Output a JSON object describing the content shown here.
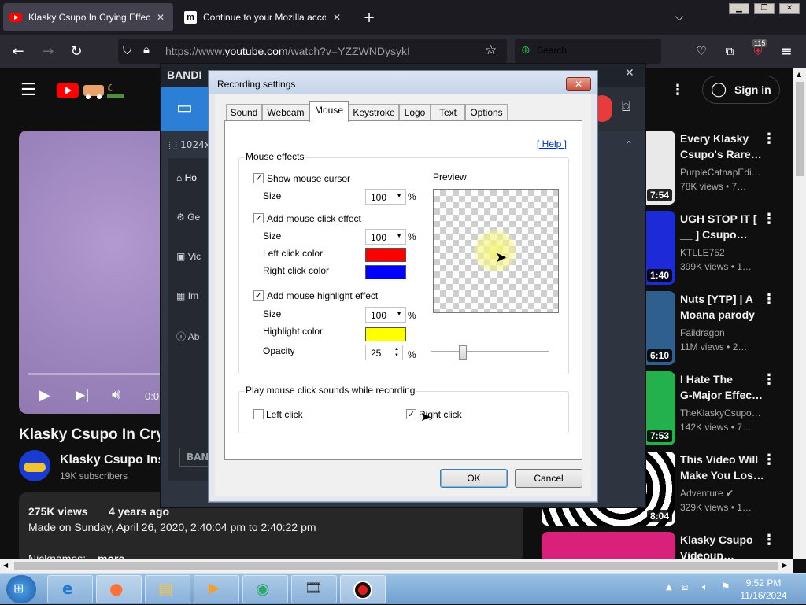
{
  "browser": {
    "tabs": [
      {
        "title": "Klasky Csupo In Crying Effect (K",
        "active": true
      },
      {
        "title": "Continue to your Mozilla accou",
        "active": false
      }
    ],
    "new_tab_glyph": "+",
    "url_prefix": "https://www.",
    "url_host": "youtube.com",
    "url_rest": "/watch?v=YZZWNDysykI",
    "search_placeholder": "Search",
    "extensions_badge": "115"
  },
  "youtube": {
    "sign_in": "Sign in",
    "video_title": "Klasky Csupo In Cry",
    "channel_name": "Klasky Csupo Inst",
    "subscribers": "19K subscribers",
    "player_time": "0:0",
    "views": "275K views",
    "age": "4 years ago",
    "description": "Made on Sunday, April 26, 2020, 2:40:04 pm to 2:40:22 pm",
    "nicknames": "Nicknames:",
    "more": "more",
    "related": [
      {
        "title1": "Every Klasky",
        "title2": "Csupo's Rare…",
        "channel": "PurpleCatnapEdi…",
        "meta": "78K views  • 7…",
        "duration": "7:54",
        "thumb": "#e9e9e9"
      },
      {
        "title1": "UGH STOP IT [",
        "title2": "__ ] Csupo…",
        "channel": "KTLLE752",
        "meta": "399K views  • 1…",
        "duration": "1:40",
        "thumb": "#1c2ad8"
      },
      {
        "title1": "Nuts [YTP] | A",
        "title2": "Moana parody",
        "channel": "Faildragon",
        "meta": "11M views  • 2…",
        "duration": "6:10",
        "thumb": "#2f5f8f"
      },
      {
        "title1": "I Hate The",
        "title2": "G-Major Effec…",
        "channel": "TheKlaskyCsupo…",
        "meta": "142K views  • 7…",
        "duration": "7:53",
        "thumb": "#22b14c"
      },
      {
        "title1": "This Video Will",
        "title2": "Make You Los…",
        "channel": "Adventure",
        "meta": "329K views  • 1…",
        "duration": "8:04",
        "thumb": "#101010"
      },
      {
        "title1": "Klasky Csupo",
        "title2": "Videoup…",
        "channel": "",
        "meta": "",
        "duration": "",
        "thumb": "#d9207a"
      }
    ]
  },
  "bandicam": {
    "title": "BANDI",
    "resolution": "1024x",
    "side_items": [
      "Ho",
      "Ge",
      "Vic",
      "Im",
      "Ab"
    ],
    "bottom_label": "BAN"
  },
  "dialog": {
    "title": "Recording settings",
    "tabs": [
      "Sound",
      "Webcam",
      "Mouse",
      "Keystroke",
      "Logo",
      "Text",
      "Options"
    ],
    "active_tab": "Mouse",
    "help": "[ Help ]",
    "mouse_effects_label": "Mouse effects",
    "preview_label": "Preview",
    "show_cursor": {
      "label": "Show mouse cursor",
      "checked": true,
      "size_label": "Size",
      "size": "100"
    },
    "click_effect": {
      "label": "Add mouse click effect",
      "checked": true,
      "size_label": "Size",
      "size": "100",
      "left_label": "Left click color",
      "left_color": "#ff0000",
      "right_label": "Right click color",
      "right_color": "#0000ff"
    },
    "highlight": {
      "label": "Add mouse highlight effect",
      "checked": true,
      "size_label": "Size",
      "size": "100",
      "color_label": "Highlight color",
      "color": "#ffff00",
      "opacity_label": "Opacity",
      "opacity": "25"
    },
    "percent": "%",
    "sounds_label": "Play mouse click sounds while recording",
    "left_click": {
      "label": "Left click",
      "checked": false
    },
    "right_click": {
      "label": "Right click",
      "checked": true
    },
    "ok": "OK",
    "cancel": "Cancel"
  },
  "taskbar": {
    "time": "9:52 PM",
    "date": "11/16/2024"
  }
}
